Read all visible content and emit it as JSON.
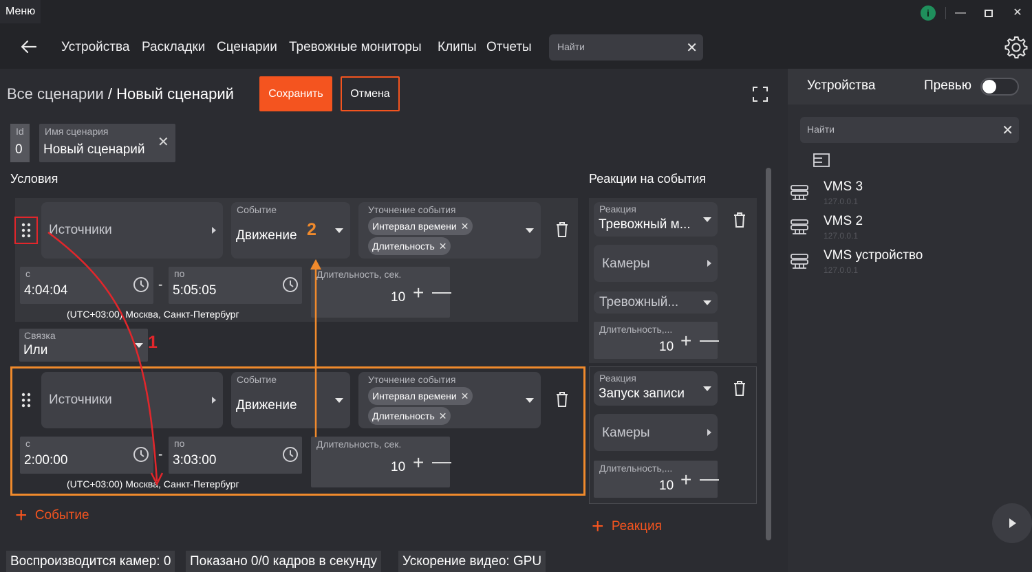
{
  "titlebar": {
    "menu_label": "Меню",
    "info_label": "i"
  },
  "nav": {
    "items": [
      "Устройства",
      "Раскладки",
      "Сценарии",
      "Тревожные мониторы",
      "Клипы",
      "Отчеты"
    ],
    "search_placeholder": "Найти"
  },
  "header": {
    "breadcrumb_root": "Все сценарии",
    "breadcrumb_sep": " / ",
    "breadcrumb_current": "Новый сценарий",
    "save_label": "Сохранить",
    "cancel_label": "Отмена"
  },
  "scenario": {
    "id_label": "Id",
    "id_value": "0",
    "name_label": "Имя сценария",
    "name_value": "Новый сценарий"
  },
  "conditions": {
    "title": "Условия",
    "rows": [
      {
        "source_label": "Источники",
        "event_label": "Событие",
        "event_value": "Движение",
        "refine_label": "Уточнение события",
        "chips": [
          "Интервал времени",
          "Длительность"
        ],
        "from_label": "с",
        "from_value": "4:04:04",
        "to_label": "по",
        "to_value": "5:05:05",
        "duration_label": "Длительность, сек.",
        "duration_value": "10",
        "timezone": "(UTC+03:00) Москва, Санкт-Петербург"
      },
      {
        "source_label": "Источники",
        "event_label": "Событие",
        "event_value": "Движение",
        "refine_label": "Уточнение события",
        "chips": [
          "Интервал времени",
          "Длительность"
        ],
        "from_label": "с",
        "from_value": "2:00:00",
        "to_label": "по",
        "to_value": "3:03:00",
        "duration_label": "Длительность, сек.",
        "duration_value": "10",
        "timezone": "(UTC+03:00) Москва, Санкт-Петербург"
      }
    ],
    "link_label": "Связка",
    "link_value": "Или",
    "add_event_label": "Событие",
    "annotation_1": "1",
    "annotation_2": "2"
  },
  "reactions": {
    "title": "Реакции на события",
    "cards": [
      {
        "reaction_label": "Реакция",
        "reaction_value": "Тревожный м...",
        "cameras_label": "Камеры",
        "alarm_value": "Тревожный...",
        "duration_label": "Длительность,...",
        "duration_value": "10"
      },
      {
        "reaction_label": "Реакция",
        "reaction_value": "Запуск записи",
        "cameras_label": "Камеры",
        "duration_label": "Длительность,...",
        "duration_value": "10"
      }
    ],
    "add_reaction_label": "Реакция"
  },
  "right_panel": {
    "title": "Устройства",
    "preview_label": "Превью",
    "preview_on": false,
    "search_placeholder": "Найти",
    "devices": [
      {
        "name": "VMS 3",
        "ip": "127.0.0.1"
      },
      {
        "name": "VMS 2",
        "ip": "127.0.0.1"
      },
      {
        "name": "VMS устройство",
        "ip": "127.0.0.1"
      }
    ]
  },
  "status": {
    "cameras": "Воспроизводится камер: 0",
    "fps": "Показано 0/0 кадров в секунду",
    "accel": "Ускорение видео: GPU"
  },
  "colors": {
    "accent": "#f4541f",
    "annotation_red": "#e2262b",
    "annotation_orange": "#f08a2c",
    "background": "#2b2c31"
  }
}
